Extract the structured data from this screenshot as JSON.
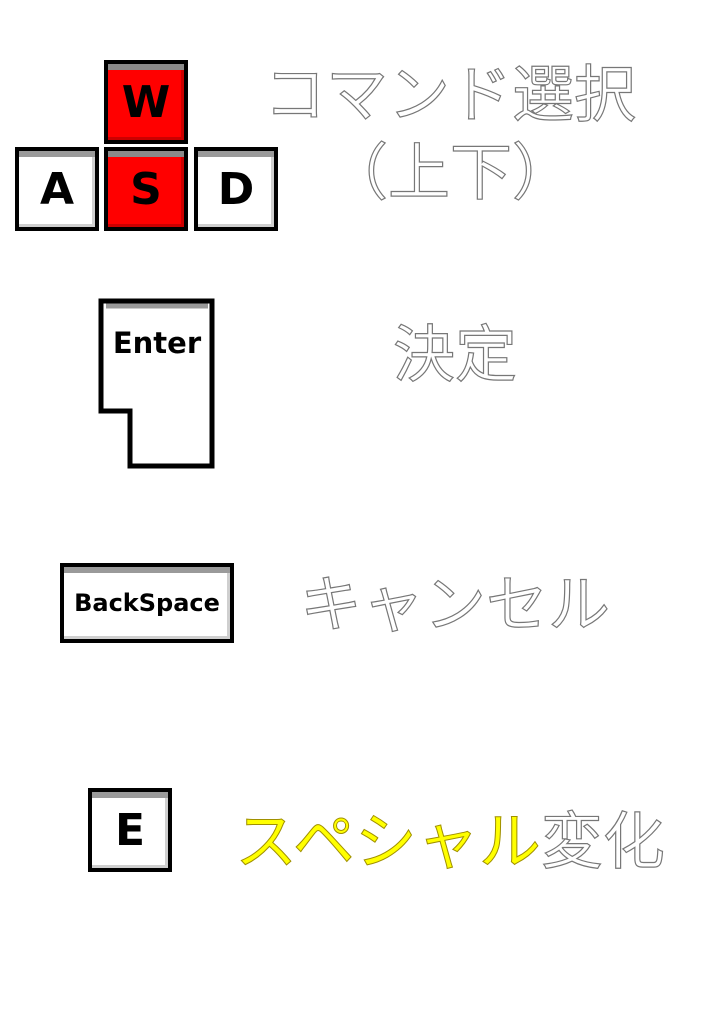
{
  "move": {
    "keys": {
      "up": "W",
      "left": "A",
      "down": "S",
      "right": "D"
    },
    "label_line1": "コマンド選択",
    "label_line2": "（上下）",
    "highlight_color": "#ff0000"
  },
  "confirm": {
    "key": "Enter",
    "label": "決定"
  },
  "cancel": {
    "key": "BackSpace",
    "label": "キャンセル"
  },
  "special": {
    "key": "E",
    "label_highlight": "スペシャル",
    "label_rest": "変化",
    "highlight_color": "#ffff00"
  }
}
